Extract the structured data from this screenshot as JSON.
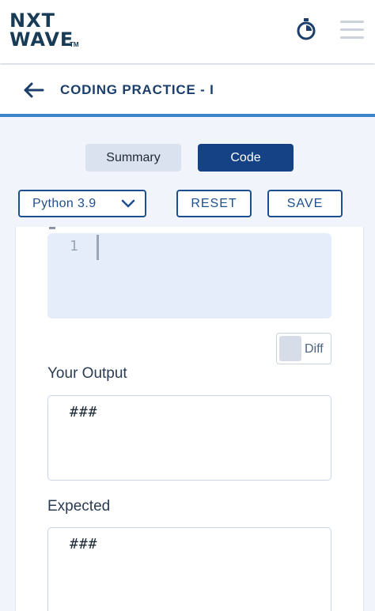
{
  "brand": {
    "logo_line1": "NXT",
    "logo_line2": "WAVE",
    "logo_tm": "TM"
  },
  "icons": {
    "timer": "stopwatch-icon",
    "menu": "hamburger-menu-icon",
    "back": "back-arrow-icon",
    "dropdown": "chevron-down-icon"
  },
  "header": {
    "title": "CODING PRACTICE - I"
  },
  "tabs": [
    {
      "label": "Summary",
      "active": false
    },
    {
      "label": "Code",
      "active": true
    }
  ],
  "controls": {
    "language": "Python 3.9",
    "reset_label": "RESET",
    "save_label": "SAVE"
  },
  "editor": {
    "line_number": "1",
    "code": ""
  },
  "diff": {
    "label": "Diff",
    "checked": false
  },
  "output": {
    "your_output_label": "Your Output",
    "your_output_value": "###",
    "expected_label": "Expected",
    "expected_value": "###"
  },
  "colors": {
    "primary": "#154284",
    "accent_line": "#3b84c9",
    "editor_bg": "#e5edfb"
  }
}
